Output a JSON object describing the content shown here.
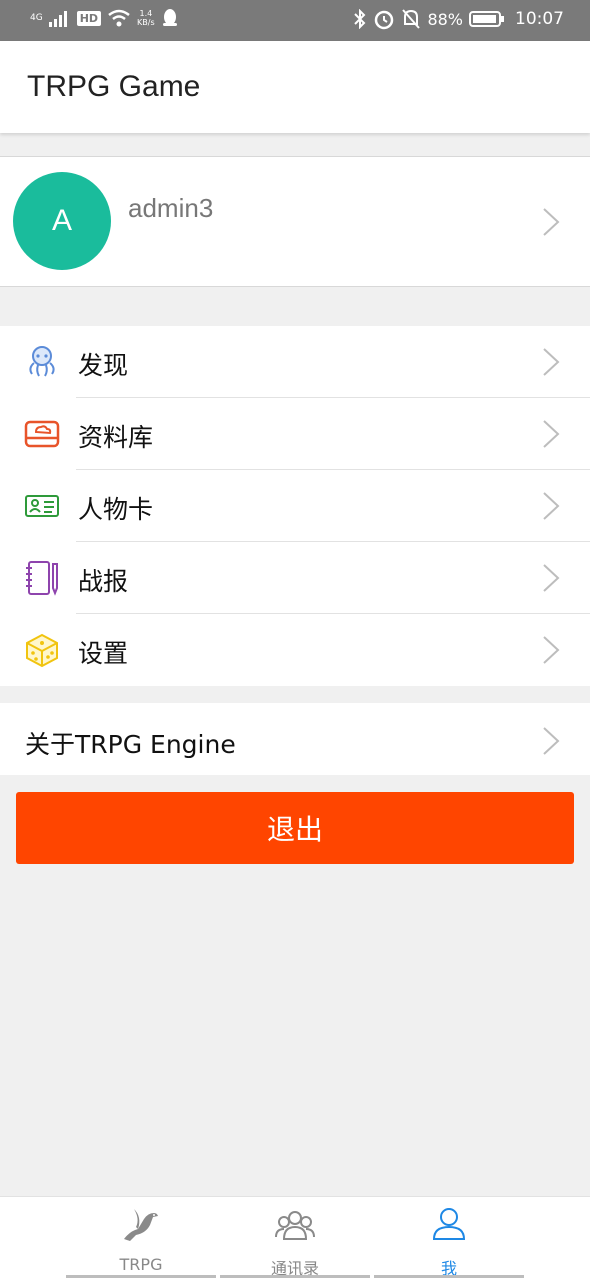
{
  "status_bar": {
    "network": "4G",
    "hd": "HD",
    "speed_value": "1.4",
    "speed_unit": "KB/s",
    "battery": "88%",
    "time": "10:07"
  },
  "app_bar": {
    "title": "TRPG Game"
  },
  "profile": {
    "avatar_letter": "A",
    "username": "admin3",
    "avatar_color": "#1abc9c"
  },
  "menu": {
    "items": [
      {
        "label": "发现",
        "icon": "octopus-icon",
        "color": "#5b8bd8"
      },
      {
        "label": "资料库",
        "icon": "storage-drive-icon",
        "color": "#e8542a"
      },
      {
        "label": "人物卡",
        "icon": "id-card-icon",
        "color": "#2e9a3a"
      },
      {
        "label": "战报",
        "icon": "notebook-pencil-icon",
        "color": "#8e44ad"
      },
      {
        "label": "设置",
        "icon": "dice-icon",
        "color": "#f1c40f"
      }
    ]
  },
  "about": {
    "label": "关于TRPG Engine"
  },
  "logout": {
    "label": "退出",
    "color": "#ff4500"
  },
  "tabs": [
    {
      "label": "TRPG",
      "icon": "pigeon-icon",
      "active": false
    },
    {
      "label": "通讯录",
      "icon": "contacts-group-icon",
      "active": false
    },
    {
      "label": "我",
      "icon": "user-profile-icon",
      "active": true
    }
  ],
  "accent_color": "#1e88e5"
}
